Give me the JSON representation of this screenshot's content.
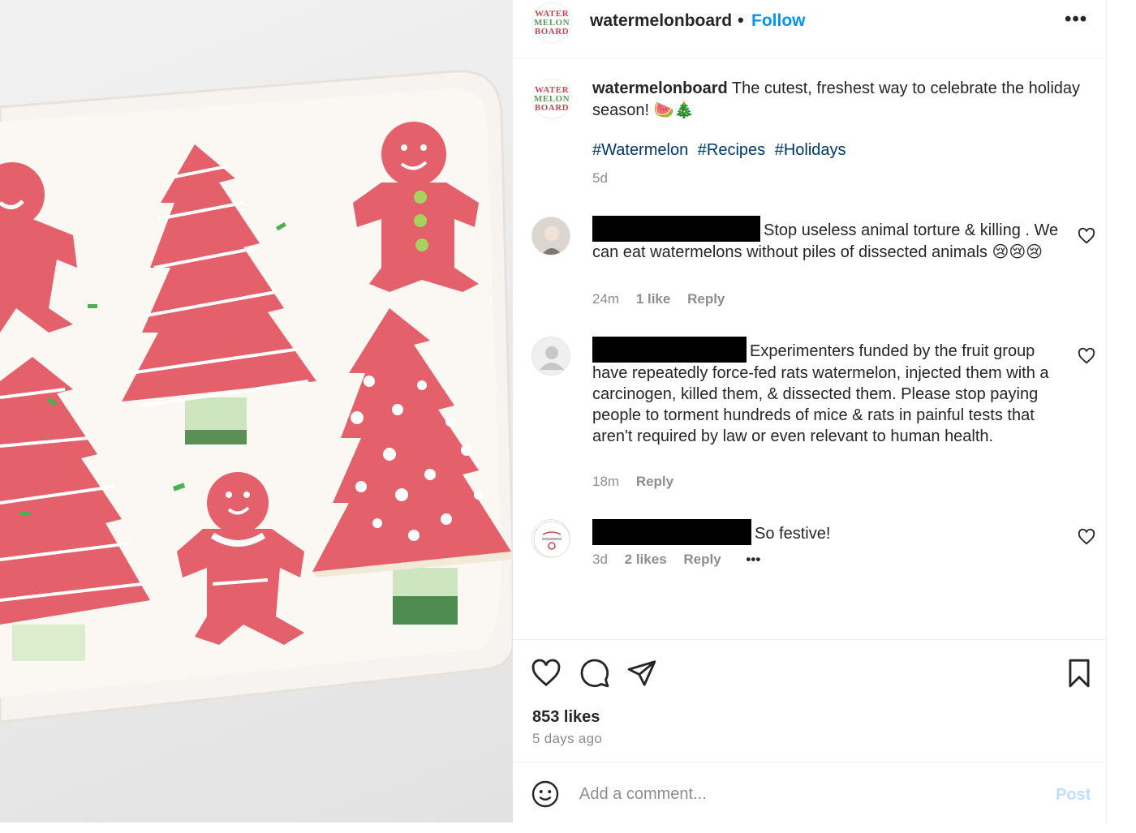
{
  "post": {
    "username": "watermelonboard",
    "separator": "•",
    "follow_label": "Follow",
    "more_label": "•••",
    "logo_text": [
      "WATER",
      "MELON",
      "BOARD"
    ],
    "caption_user": "watermelonboard",
    "caption_text": "The cutest, freshest way to celebrate the holiday season! 🍉🎄",
    "hashtags": [
      "#Watermelon",
      "#Recipes",
      "#Holidays"
    ],
    "caption_time": "5d"
  },
  "comments": [
    {
      "text": "Stop useless animal torture & killing . We can eat watermelons without piles of dissected animals 😢😢😢",
      "time": "24m",
      "likes": "1 like",
      "reply": "Reply"
    },
    {
      "text": "Experimenters funded by the fruit group have repeatedly force-fed rats watermelon, injected them with a carcinogen, killed them, & dissected them. Please stop paying people to torment hundreds of mice & rats in painful tests that aren't required by law or even relevant to human health.",
      "time": "18m",
      "reply": "Reply"
    },
    {
      "text": "So festive!",
      "time": "3d",
      "likes": "2 likes",
      "reply": "Reply",
      "more": "•••"
    }
  ],
  "footer": {
    "likes": "853 likes",
    "ago": "5 days ago",
    "comment_placeholder": "Add a comment...",
    "post_label": "Post"
  },
  "colors": {
    "follow": "#0095f6",
    "hashtag": "#00376b",
    "muted": "#8e8e8e",
    "post_disabled": "#c0dffd",
    "watermelon": "#e4606a"
  },
  "icons": [
    "heart-icon",
    "comment-icon",
    "share-icon",
    "bookmark-icon",
    "emoji-icon",
    "more-icon"
  ]
}
